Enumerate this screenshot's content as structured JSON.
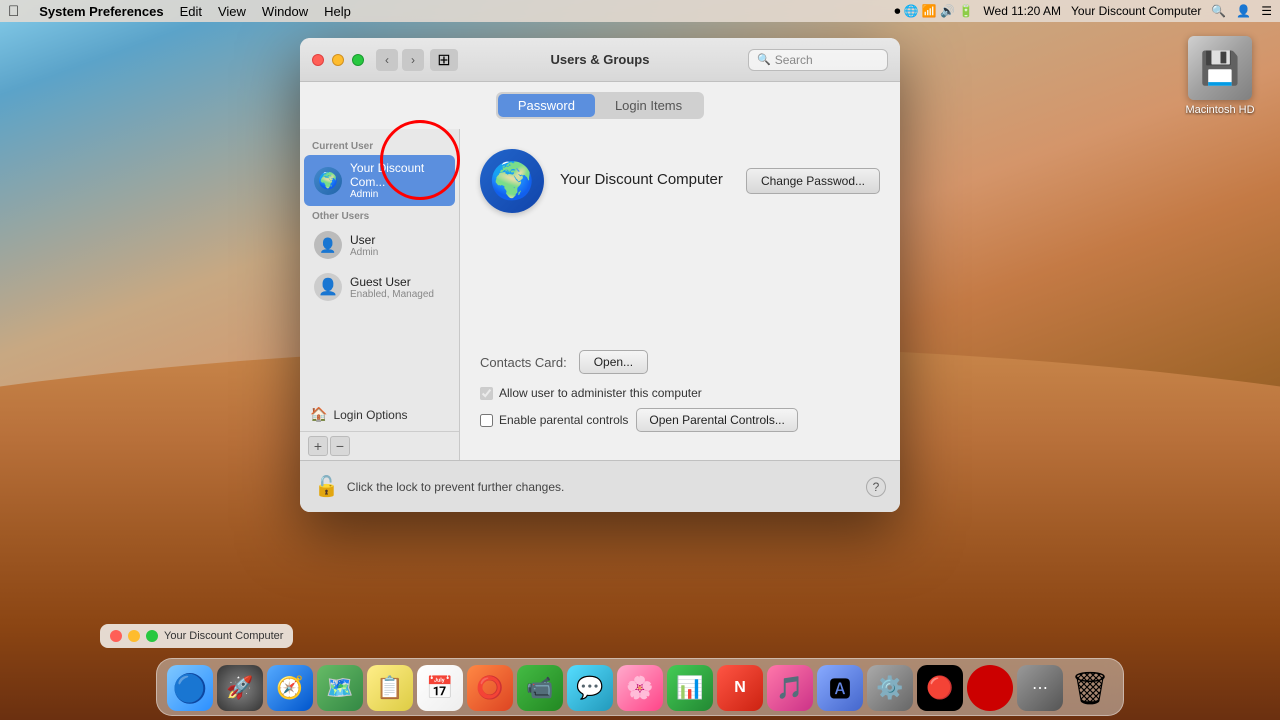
{
  "menubar": {
    "apple_label": "",
    "app_name": "System Preferences",
    "menus": [
      "Edit",
      "View",
      "Window",
      "Help"
    ],
    "right_items": [
      "Wed 11:20 AM",
      "Your Discount Computer"
    ],
    "datetime": "Wed 11:20 AM",
    "computer_name": "Your Discount Computer"
  },
  "window": {
    "title": "Users & Groups",
    "search_placeholder": "Search",
    "tabs": [
      {
        "label": "Password",
        "active": true
      },
      {
        "label": "Login Items",
        "active": false
      }
    ],
    "sidebar": {
      "current_user_label": "Current User",
      "other_users_label": "Other Users",
      "users": [
        {
          "name": "Your Discount Com...",
          "role": "Admin",
          "avatar_type": "globe",
          "selected": true
        },
        {
          "name": "User",
          "role": "Admin",
          "avatar_type": "user",
          "selected": false
        },
        {
          "name": "Guest User",
          "role": "Enabled, Managed",
          "avatar_type": "guest",
          "selected": false
        }
      ],
      "login_options_label": "Login Options",
      "add_button": "+",
      "remove_button": "−"
    },
    "main": {
      "user_name": "Your Discount Computer",
      "change_password_button": "Change Passwod...",
      "contacts_label": "Contacts Card:",
      "open_button": "Open...",
      "allow_admin_label": "Allow user to administer this computer",
      "allow_admin_checked": true,
      "parental_controls_label": "Enable parental controls",
      "parental_controls_checked": false,
      "open_parental_button": "Open Parental Controls..."
    },
    "lock_bar": {
      "lock_text": "Click the lock to prevent further changes.",
      "help_label": "?"
    }
  },
  "desktop": {
    "macintosh_hd_label": "Macintosh HD"
  },
  "floating_window": {
    "label": "Your Discount Computer"
  },
  "dock": {
    "items": [
      {
        "name": "Finder",
        "emoji": "🔵",
        "class": "di-finder"
      },
      {
        "name": "Launchpad",
        "emoji": "🚀",
        "class": "di-launchpad"
      },
      {
        "name": "Rocketship",
        "emoji": "🚀",
        "class": "di-rocketship"
      },
      {
        "name": "Safari",
        "emoji": "🧭",
        "class": "di-safari"
      },
      {
        "name": "Maps",
        "emoji": "🗺️",
        "class": "di-maps"
      },
      {
        "name": "Notes",
        "emoji": "📝",
        "class": "di-notes"
      },
      {
        "name": "Calendar",
        "emoji": "📅",
        "class": "di-calendar"
      },
      {
        "name": "Reminders",
        "emoji": "✅",
        "class": "di-reminders"
      },
      {
        "name": "FaceTime",
        "emoji": "📹",
        "class": "di-facetime"
      },
      {
        "name": "Messages",
        "emoji": "💬",
        "class": "di-messages"
      },
      {
        "name": "Photos",
        "emoji": "🖼",
        "class": "di-photos"
      },
      {
        "name": "Numbers",
        "emoji": "📊",
        "class": "di-numbers"
      },
      {
        "name": "News",
        "emoji": "📰",
        "class": "di-news"
      },
      {
        "name": "Music",
        "emoji": "🎵",
        "class": "di-music"
      },
      {
        "name": "App Store",
        "emoji": "🅰",
        "class": "di-appstore"
      },
      {
        "name": "System Preferences",
        "emoji": "⚙️",
        "class": "di-syspref"
      },
      {
        "name": "VPN",
        "emoji": "🔴",
        "class": "di-vpn"
      },
      {
        "name": "More",
        "emoji": "⋯",
        "class": "di-more"
      },
      {
        "name": "Trash",
        "emoji": "🗑",
        "class": "di-trash"
      }
    ]
  }
}
